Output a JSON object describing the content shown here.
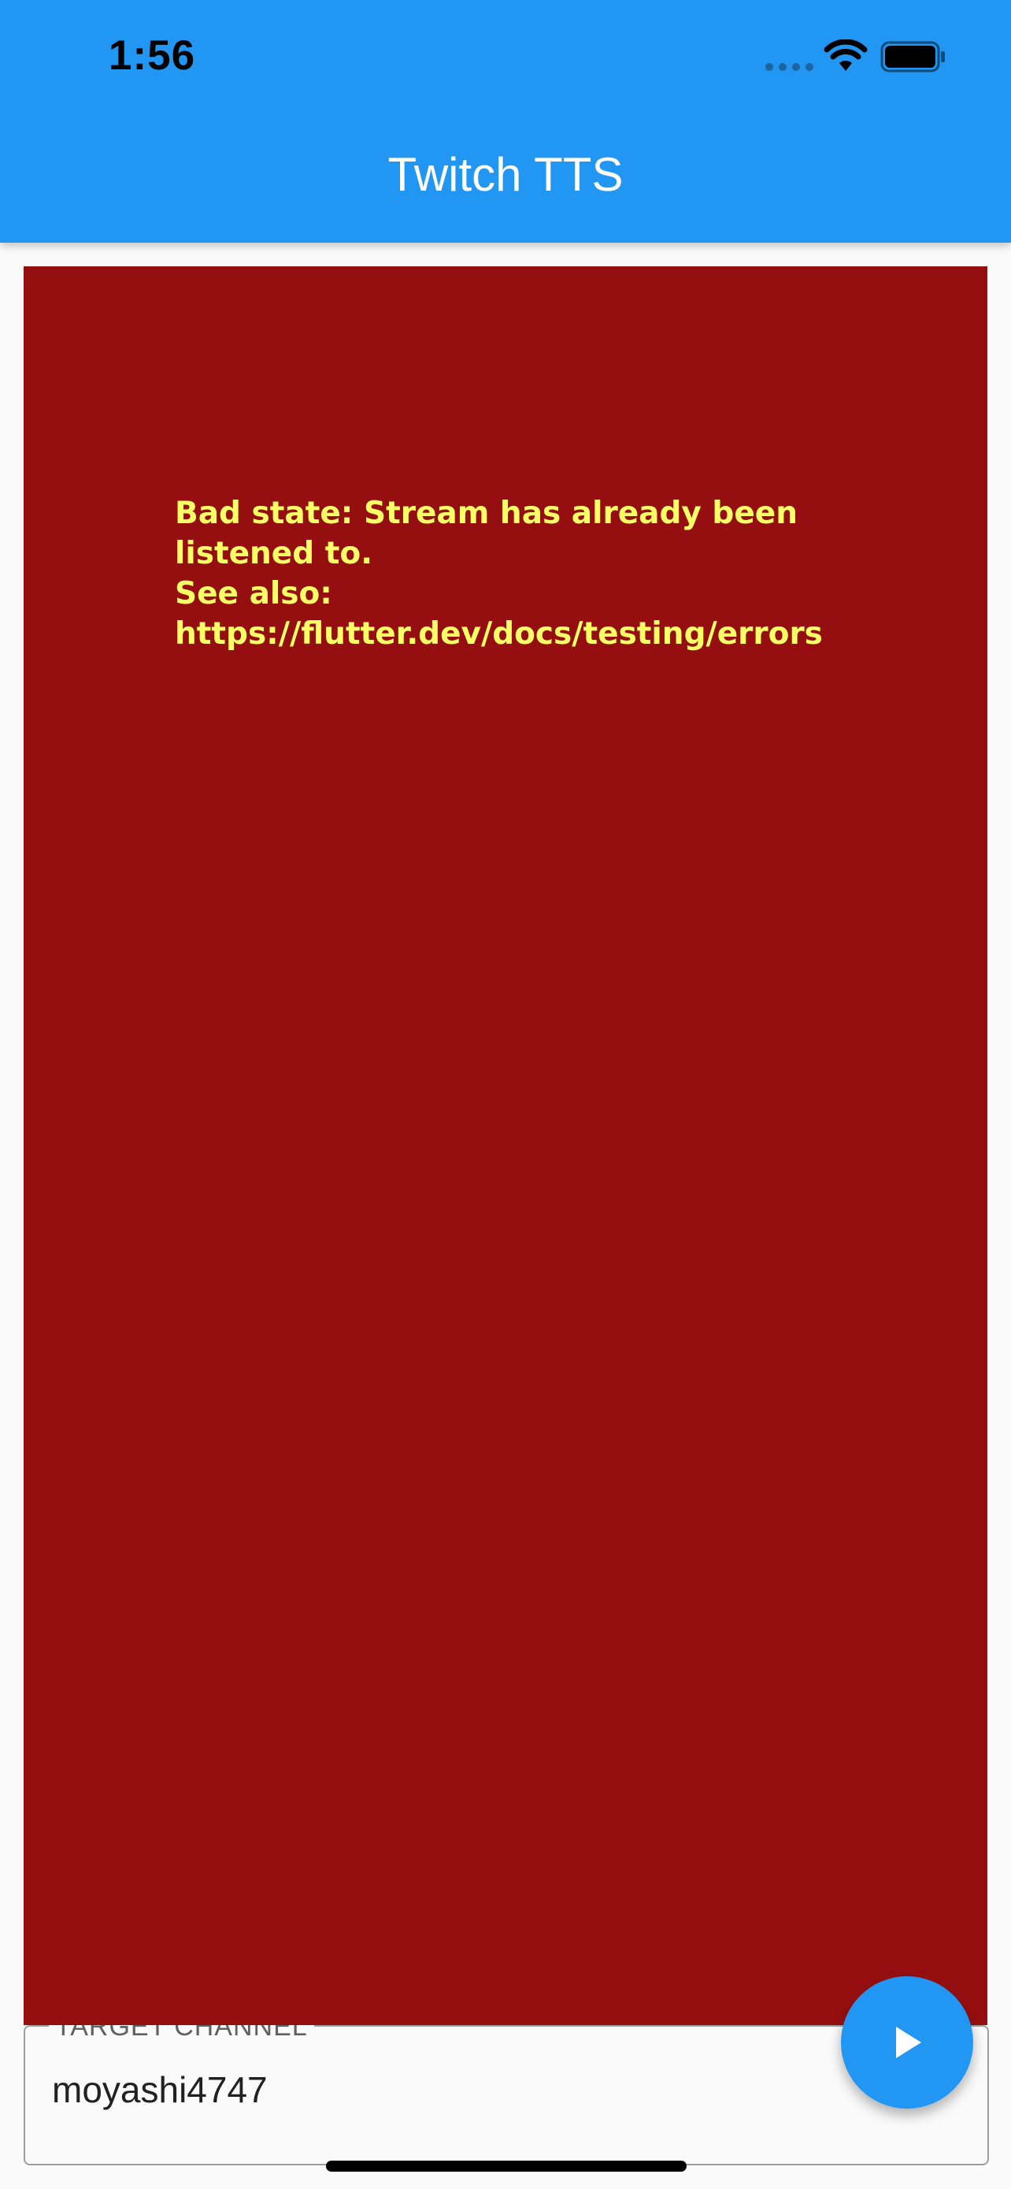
{
  "status_bar": {
    "time": "1:56",
    "icons": [
      "cellular-signal-icon",
      "wifi-icon",
      "battery-icon"
    ]
  },
  "app_bar": {
    "title": "Twitch TTS",
    "color": "#2196f3"
  },
  "error": {
    "background_color": "#960f10",
    "text_color": "#ffff66",
    "lines": [
      "Bad state: Stream has already been",
      "listened to.",
      "See also:",
      "https://flutter.dev/docs/testing/errors"
    ]
  },
  "channel_input": {
    "label": "TARGET CHANNEL",
    "value": "moyashi4747"
  },
  "fab": {
    "icon": "play-icon",
    "color": "#2196f3"
  }
}
